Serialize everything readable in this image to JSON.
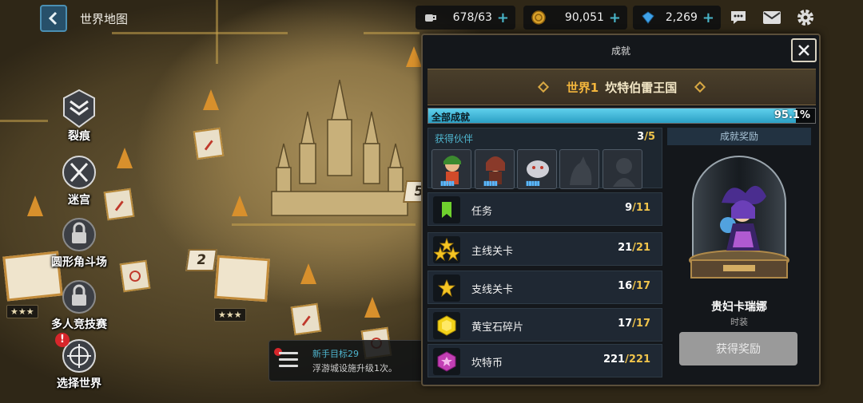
{
  "header": {
    "title": "世界地图"
  },
  "resources": [
    {
      "icon": "coffee-icon",
      "value": "678/63"
    },
    {
      "icon": "gold-coin-icon",
      "value": "90,051"
    },
    {
      "icon": "gem-icon",
      "value": "2,269"
    }
  ],
  "left_menu": [
    {
      "label": "裂痕",
      "icon": "rift-emblem-icon"
    },
    {
      "label": "迷宫",
      "icon": "labyrinth-emblem-icon"
    },
    {
      "label": "圆形角斗场",
      "icon": "colosseum-locked-icon"
    },
    {
      "label": "多人竞技赛",
      "icon": "multiplayer-locked-icon"
    },
    {
      "label": "选择世界",
      "icon": "world-select-emblem-icon"
    }
  ],
  "alert_badge": "!",
  "map": {
    "stage_number_2": "2",
    "stage_number_5": "5",
    "stars": "★★★"
  },
  "newbie_goal": {
    "title": "新手目标29",
    "desc": "浮游城设施升级1次。"
  },
  "panel": {
    "title": "成就",
    "world_number": "世界1",
    "world_name": "坎特伯雷王国",
    "overall_label": "全部成就",
    "overall_percent": "95.1%",
    "overall_fraction": 0.951,
    "companions": {
      "label": "获得伙伴",
      "count": "3",
      "total": "/5"
    },
    "rows": [
      {
        "icon": "bookmark-icon",
        "label": "任务",
        "count": "9",
        "total": "/11"
      },
      {
        "icon": "triple-star-icon",
        "label": "主线关卡",
        "count": "21",
        "total": "/21"
      },
      {
        "icon": "star-icon",
        "label": "支线关卡",
        "count": "16",
        "total": "/17"
      },
      {
        "icon": "gold-gem-icon",
        "label": "黄宝石碎片",
        "count": "17",
        "total": "/17"
      },
      {
        "icon": "canterbury-coin-icon",
        "label": "坎特币",
        "count": "221",
        "total": "/221"
      }
    ],
    "reward": {
      "header": "成就奖励",
      "name": "贵妇卡瑞娜",
      "type": "时装",
      "button": "获得奖励"
    }
  },
  "colors": {
    "accent_blue": "#4fb6cf",
    "gold": "#f0c44b",
    "progress_fill": "#2b9fc4"
  }
}
